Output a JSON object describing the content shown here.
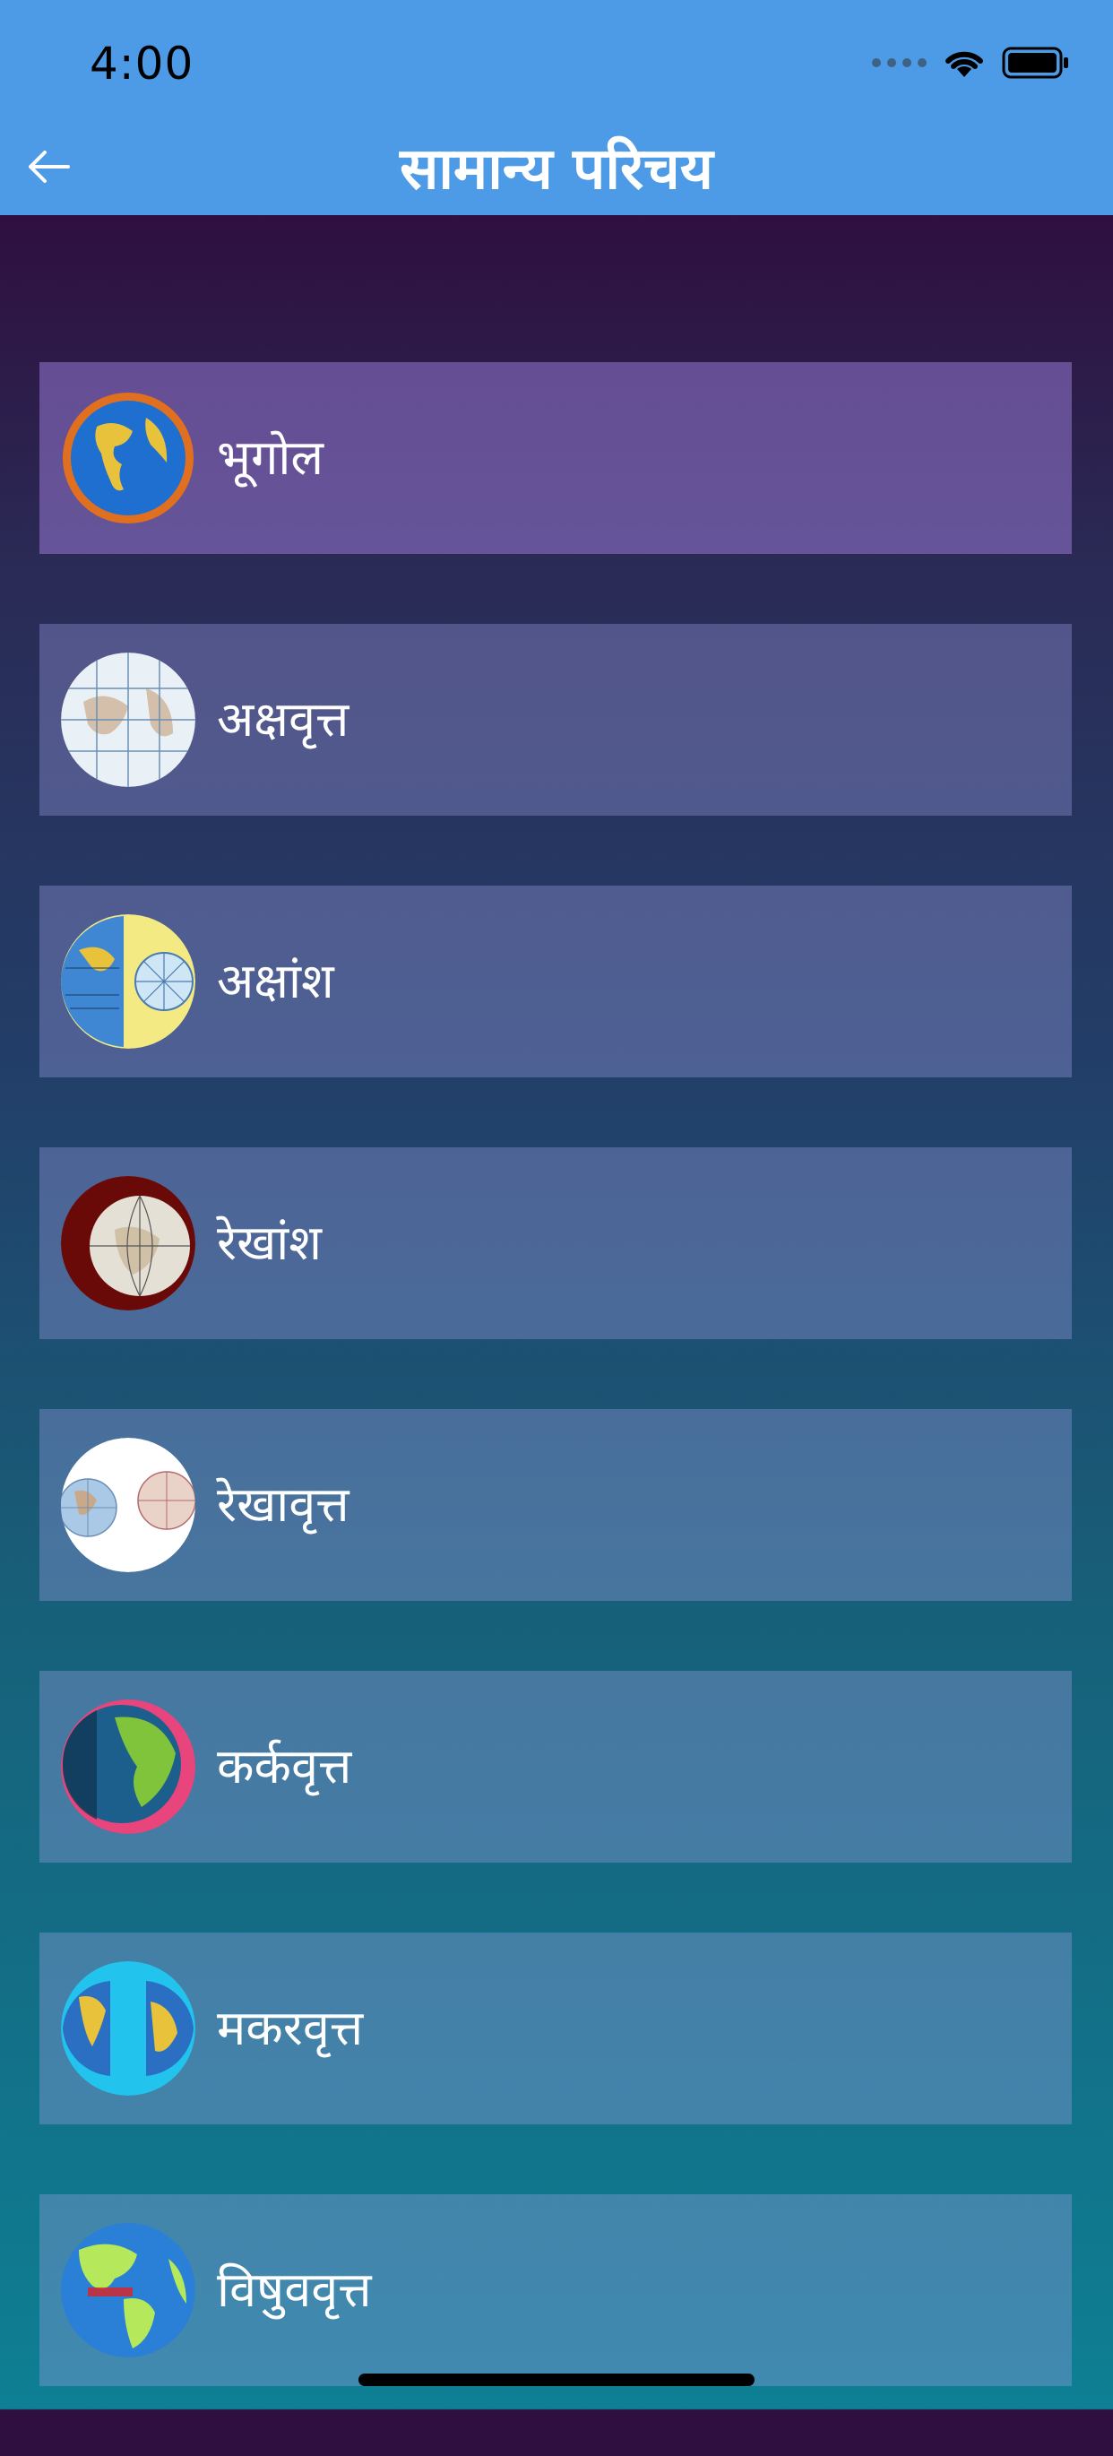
{
  "status_bar": {
    "time": "4:00"
  },
  "header": {
    "title": "सामान्य परिचय"
  },
  "items": [
    {
      "label": "भूगोल",
      "icon": "globe-americas-icon"
    },
    {
      "label": "अक्षवृत्त",
      "icon": "latitude-globe-icon"
    },
    {
      "label": "अक्षांश",
      "icon": "latitude-diagram-icon"
    },
    {
      "label": "रेखांश",
      "icon": "longitude-globe-icon"
    },
    {
      "label": "रेखावृत्त",
      "icon": "meridian-hemispheres-icon"
    },
    {
      "label": "कर्कवृत्त",
      "icon": "tropic-of-cancer-globe-icon"
    },
    {
      "label": "मकरवृत्त",
      "icon": "tropic-of-capricorn-hemispheres-icon"
    },
    {
      "label": "विषुववृत्त",
      "icon": "equator-globe-icon"
    }
  ],
  "colors": {
    "header_bg": "#4d9be6",
    "text": "#ffffff"
  }
}
